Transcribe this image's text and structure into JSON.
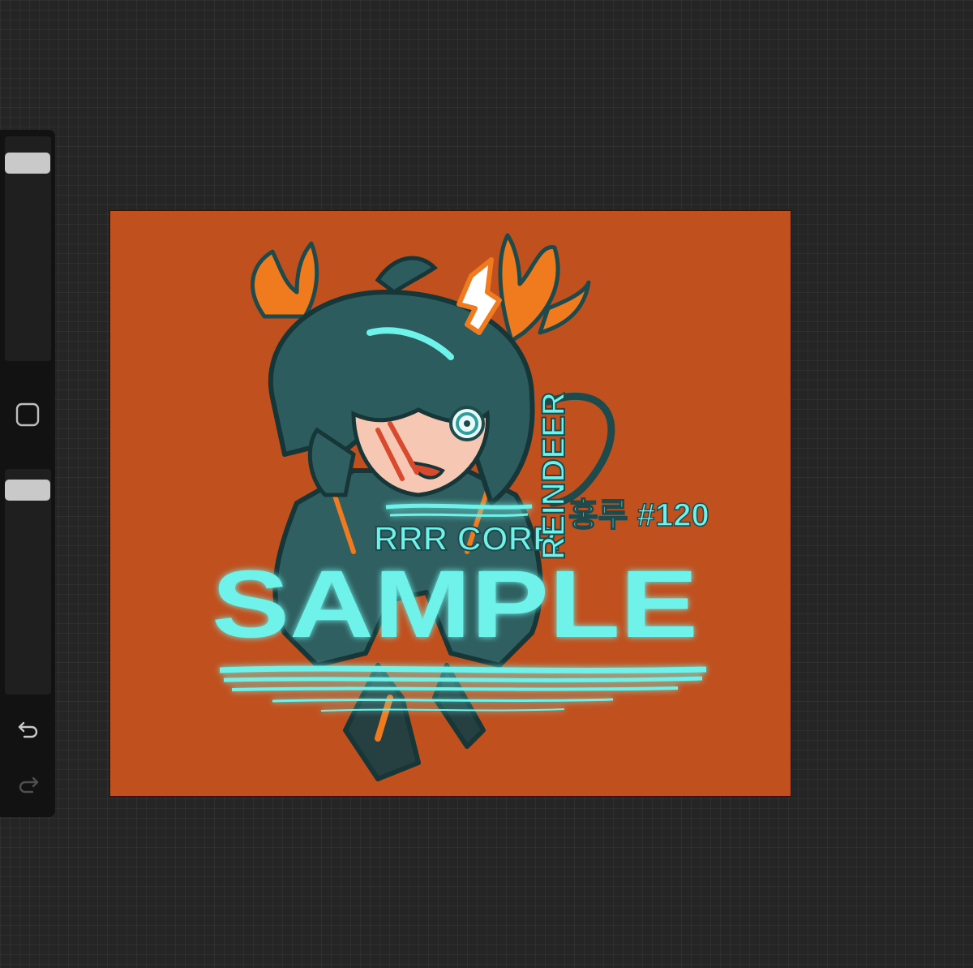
{
  "colors": {
    "app_background": "#252525",
    "sidebar_background": "#121212",
    "slider_track": "#1f1f1f",
    "slider_thumb": "#c9c9c9",
    "canvas_background": "#c0501e",
    "art_cyan": "#6ef2ea",
    "art_teal": "#1f4a4c",
    "art_orange": "#f07a1e"
  },
  "sidebar": {
    "brush_size_level": 0.08,
    "brush_opacity_level": 0.05,
    "icons": {
      "modify": "square-outline-icon",
      "undo": "undo-arrow-icon",
      "redo": "redo-arrow-icon"
    }
  },
  "artwork": {
    "corp_text": "RRR CORP.",
    "vertical_text": "REINDEER",
    "korean_text": "홍루 #120",
    "watermark": "SAMPLE"
  }
}
